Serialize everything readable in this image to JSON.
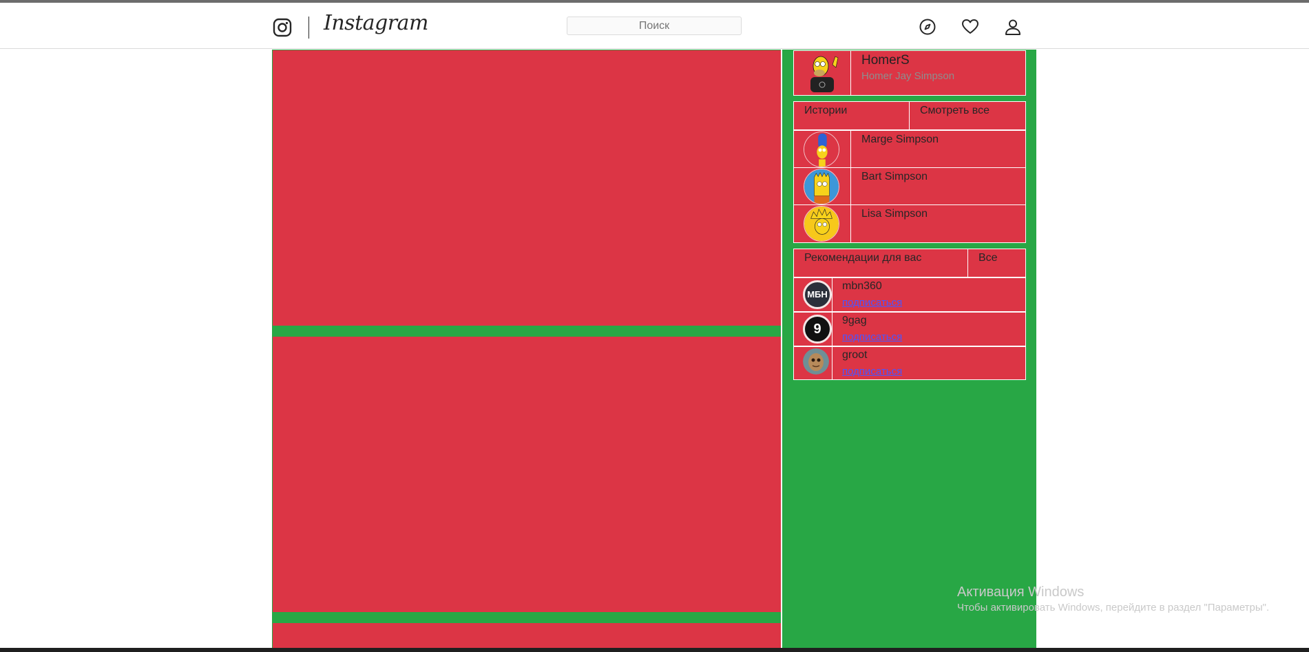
{
  "header": {
    "logo_text": "Instagram",
    "search_placeholder": "Поиск"
  },
  "profile": {
    "username": "HomerS",
    "full_name": "Homer Jay Simpson"
  },
  "stories": {
    "title": "Истории",
    "see_all": "Смотреть все",
    "items": [
      {
        "name": "Marge Simpson"
      },
      {
        "name": "Bart Simpson"
      },
      {
        "name": "Lisa Simpson"
      }
    ]
  },
  "suggestions": {
    "title": "Рекомендации для вас",
    "all": "Все",
    "follow_label": "подписаться",
    "items": [
      {
        "name": "mbn360",
        "avatar_text": "МБН"
      },
      {
        "name": "9gag",
        "avatar_text": "9"
      },
      {
        "name": "groot"
      }
    ]
  },
  "watermark": {
    "line1": "Активация Windows",
    "line2": "Чтобы активировать Windows, перейдите в раздел \"Параметры\"."
  },
  "colors": {
    "card": "#dc3545",
    "background": "#28a745",
    "link": "#4a55ff"
  }
}
